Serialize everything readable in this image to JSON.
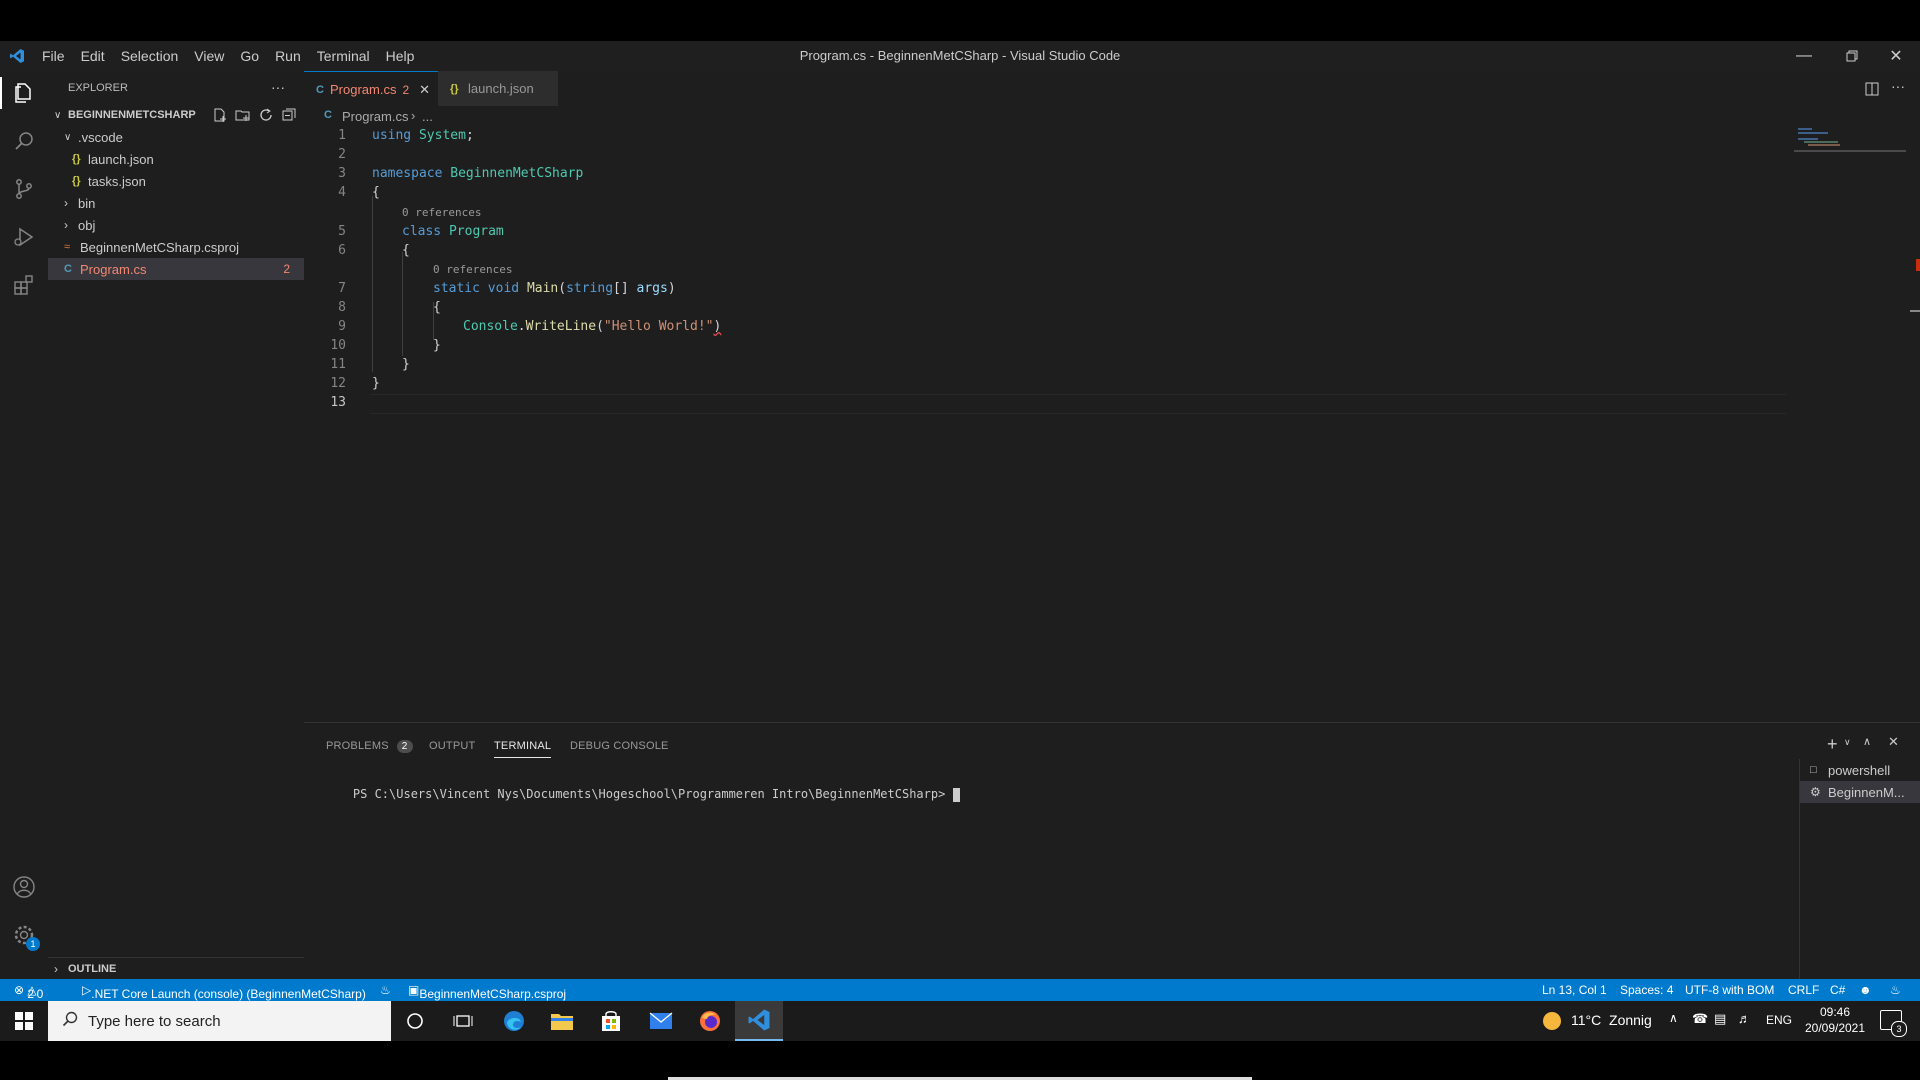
{
  "window": {
    "title": "Program.cs - BeginnenMetCSharp - Visual Studio Code",
    "menu": [
      "File",
      "Edit",
      "Selection",
      "View",
      "Go",
      "Run",
      "Terminal",
      "Help"
    ]
  },
  "sidebar": {
    "header": "EXPLORER",
    "more": "···",
    "project": "BEGINNENMETCSHARP",
    "items": [
      {
        "label": ".vscode",
        "type": "folder-open"
      },
      {
        "label": "launch.json",
        "type": "json"
      },
      {
        "label": "tasks.json",
        "type": "json"
      },
      {
        "label": "bin",
        "type": "folder"
      },
      {
        "label": "obj",
        "type": "folder"
      },
      {
        "label": "BeginnenMetCSharp.csproj",
        "type": "rss"
      },
      {
        "label": "Program.cs",
        "type": "cs",
        "badge": "2"
      }
    ],
    "outline": "OUTLINE"
  },
  "tabs": [
    {
      "label": "Program.cs",
      "badge": "2",
      "active": true
    },
    {
      "label": "launch.json",
      "active": false
    }
  ],
  "breadcrumb": {
    "file": "Program.cs",
    "rest": "..."
  },
  "editor": {
    "line_numbers": [
      "1",
      "2",
      "3",
      "4",
      "5",
      "6",
      "7",
      "8",
      "9",
      "10",
      "11",
      "12",
      "13"
    ],
    "codelens_class": "0 references",
    "codelens_main": "0 references",
    "code": {
      "l1a": "using",
      "l1b": "System",
      "l1c": ";",
      "l3a": "namespace",
      "l3b": "BeginnenMetCSharp",
      "l4": "{",
      "l5a": "class",
      "l5b": "Program",
      "l6": "{",
      "l7a": "static",
      "l7b": "void",
      "l7c": "Main",
      "l7d": "(",
      "l7e": "string",
      "l7f": "[] ",
      "l7g": "args",
      "l7h": ")",
      "l8": "{",
      "l9a": "Console",
      "l9b": ".",
      "l9c": "WriteLine",
      "l9d": "(",
      "l9e": "\"Hello World!\"",
      "l9f": ")",
      "l10": "}",
      "l11": "}",
      "l12": "}"
    }
  },
  "panel": {
    "tabs": [
      "PROBLEMS",
      "OUTPUT",
      "TERMINAL",
      "DEBUG CONSOLE"
    ],
    "problems_count": "2",
    "prompt": "PS C:\\Users\\Vincent Nys\\Documents\\Hogeschool\\Programmeren Intro\\BeginnenMetCSharp>",
    "terminals": [
      "powershell",
      "BeginnenM..."
    ]
  },
  "statusbar": {
    "errors": "2",
    "warnings": "0",
    "launch": ".NET Core Launch (console) (BeginnenMetCSharp)",
    "project": "BeginnenMetCSharp.csproj",
    "position": "Ln 13, Col 1",
    "spaces": "Spaces: 4",
    "encoding": "UTF-8 with BOM",
    "eol": "CRLF",
    "language": "C#"
  },
  "taskbar": {
    "search_placeholder": "Type here to search",
    "weather": "11°C  Zonnig",
    "language": "ENG",
    "time": "09:46",
    "date": "20/09/2021",
    "notifications": "3"
  },
  "colors": {
    "accent": "#007acc",
    "keyword": "#569cd6",
    "type": "#4ec9b0",
    "method": "#dcdcaa",
    "string": "#ce9178",
    "variable": "#9cdcfe",
    "error": "#f48771"
  }
}
